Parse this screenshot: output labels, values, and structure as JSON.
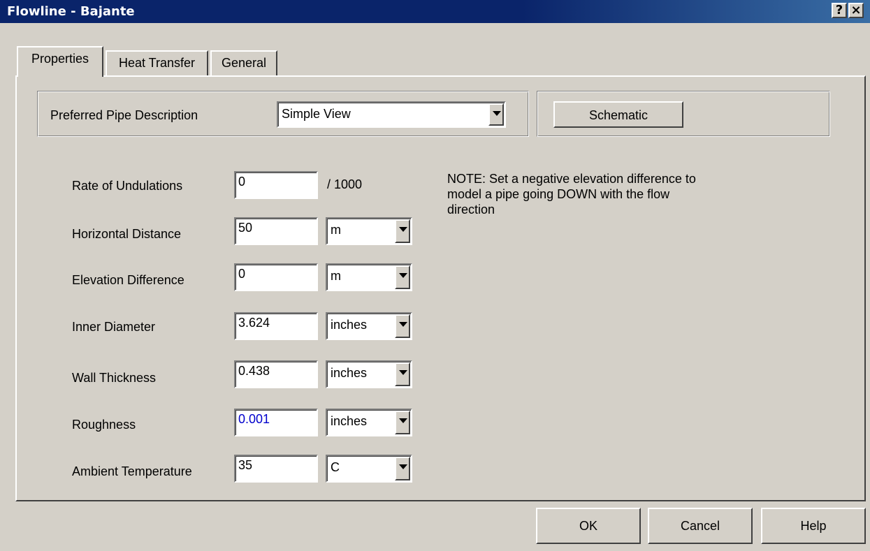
{
  "window": {
    "title": "Flowline - Bajante",
    "help_label": "?",
    "close_label": "×"
  },
  "tabs": [
    {
      "label": "Properties",
      "active": true
    },
    {
      "label": "Heat Transfer",
      "active": false
    },
    {
      "label": "General",
      "active": false
    }
  ],
  "description": {
    "label": "Preferred Pipe Description",
    "value": "Simple View",
    "schematic_label": "Schematic"
  },
  "fields": {
    "undulations": {
      "label": "Rate of Undulations",
      "value": "0",
      "suffix": "/ 1000"
    },
    "horizontal_distance": {
      "label": "Horizontal Distance",
      "value": "50",
      "unit": "m"
    },
    "elevation_difference": {
      "label": "Elevation Difference",
      "value": "0",
      "unit": "m"
    },
    "inner_diameter": {
      "label": "Inner Diameter",
      "value": "3.624",
      "unit": "inches"
    },
    "wall_thickness": {
      "label": "Wall Thickness",
      "value": "0.438",
      "unit": "inches"
    },
    "roughness": {
      "label": "Roughness",
      "value": "0.001",
      "unit": "inches",
      "color": "#0000cc"
    },
    "ambient_temperature": {
      "label": "Ambient Temperature",
      "value": "35",
      "unit": "C"
    }
  },
  "note": {
    "line1": "NOTE: Set a negative elevation difference to",
    "line2": "model a pipe going DOWN with the flow",
    "line3": "direction"
  },
  "buttons": {
    "ok": "OK",
    "cancel": "Cancel",
    "help": "Help"
  },
  "colors": {
    "title_bar": "#0a246a",
    "face": "#d4d0c8"
  }
}
